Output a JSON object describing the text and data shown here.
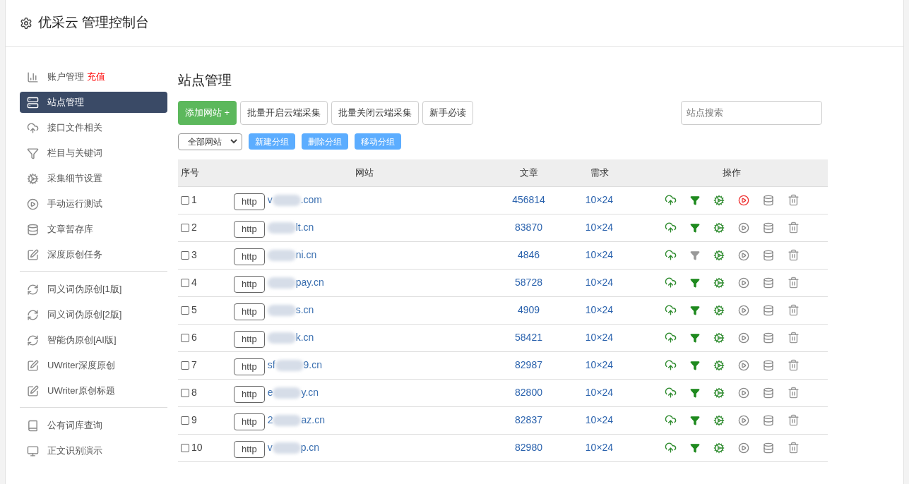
{
  "header": {
    "title": "优采云 管理控制台"
  },
  "sidebar": {
    "groups": [
      [
        {
          "kind": "chart",
          "label": "账户管理",
          "badge": "充值",
          "selected": false
        },
        {
          "kind": "server",
          "label": "站点管理",
          "selected": true
        },
        {
          "kind": "cloud",
          "label": "接口文件相关",
          "selected": false
        },
        {
          "kind": "filter",
          "label": "栏目与关键词",
          "selected": false
        },
        {
          "kind": "gears",
          "label": "采集细节设置",
          "selected": false
        },
        {
          "kind": "play",
          "label": "手动运行测试",
          "selected": false
        },
        {
          "kind": "database",
          "label": "文章暂存库",
          "selected": false
        },
        {
          "kind": "edit",
          "label": "深度原创任务",
          "selected": false
        }
      ],
      [
        {
          "kind": "refresh",
          "label": "同义词伪原创[1版]",
          "selected": false
        },
        {
          "kind": "refresh",
          "label": "同义词伪原创[2版]",
          "selected": false
        },
        {
          "kind": "refresh",
          "label": "智能伪原创[AI版]",
          "selected": false
        },
        {
          "kind": "edit",
          "label": "UWriter深度原创",
          "selected": false
        },
        {
          "kind": "edit",
          "label": "UWriter原创标题",
          "selected": false
        }
      ],
      [
        {
          "kind": "book",
          "label": "公有词库查询",
          "selected": false
        },
        {
          "kind": "monitor",
          "label": "正文识别演示",
          "selected": false
        }
      ]
    ]
  },
  "main": {
    "title": "站点管理",
    "add_button": "添加网站 +",
    "buttons": [
      "批量开启云端采集",
      "批量关闭云端采集",
      "新手必读"
    ],
    "search": {
      "placeholder": "站点搜索"
    },
    "group_select": "全部网站",
    "group_buttons": [
      "新建分组",
      "删除分组",
      "移动分组"
    ],
    "table": {
      "columns": [
        "序号",
        "网站",
        "文章",
        "需求",
        "操作"
      ],
      "rows": [
        {
          "checked": false,
          "index": "1",
          "scheme": "http",
          "site_start": "v",
          "site_end": ".com",
          "articles": "456814",
          "demand": "10×24",
          "filter_on": true,
          "running": true
        },
        {
          "checked": false,
          "index": "2",
          "scheme": "http",
          "site_start": "",
          "site_end": "lt.cn",
          "articles": "83870",
          "demand": "10×24",
          "filter_on": true,
          "running": false
        },
        {
          "checked": false,
          "index": "3",
          "scheme": "http",
          "site_start": "",
          "site_end": "ni.cn",
          "articles": "4846",
          "demand": "10×24",
          "filter_on": false,
          "running": false
        },
        {
          "checked": false,
          "index": "4",
          "scheme": "http",
          "site_start": "",
          "site_end": "pay.cn",
          "articles": "58728",
          "demand": "10×24",
          "filter_on": true,
          "running": false
        },
        {
          "checked": false,
          "index": "5",
          "scheme": "http",
          "site_start": "",
          "site_end": "s.cn",
          "articles": "4909",
          "demand": "10×24",
          "filter_on": true,
          "running": false
        },
        {
          "checked": false,
          "index": "6",
          "scheme": "http",
          "site_start": "",
          "site_end": "k.cn",
          "articles": "58421",
          "demand": "10×24",
          "filter_on": true,
          "running": false
        },
        {
          "checked": false,
          "index": "7",
          "scheme": "http",
          "site_start": "sf",
          "site_end": "9.cn",
          "articles": "82987",
          "demand": "10×24",
          "filter_on": true,
          "running": false
        },
        {
          "checked": false,
          "index": "8",
          "scheme": "http",
          "site_start": "e",
          "site_end": "y.cn",
          "articles": "82800",
          "demand": "10×24",
          "filter_on": true,
          "running": false
        },
        {
          "checked": false,
          "index": "9",
          "scheme": "http",
          "site_start": "2",
          "site_end": "az.cn",
          "articles": "82837",
          "demand": "10×24",
          "filter_on": true,
          "running": false
        },
        {
          "checked": false,
          "index": "10",
          "scheme": "http",
          "site_start": "v",
          "site_end": "p.cn",
          "articles": "82980",
          "demand": "10×24",
          "filter_on": true,
          "running": false
        }
      ]
    }
  }
}
